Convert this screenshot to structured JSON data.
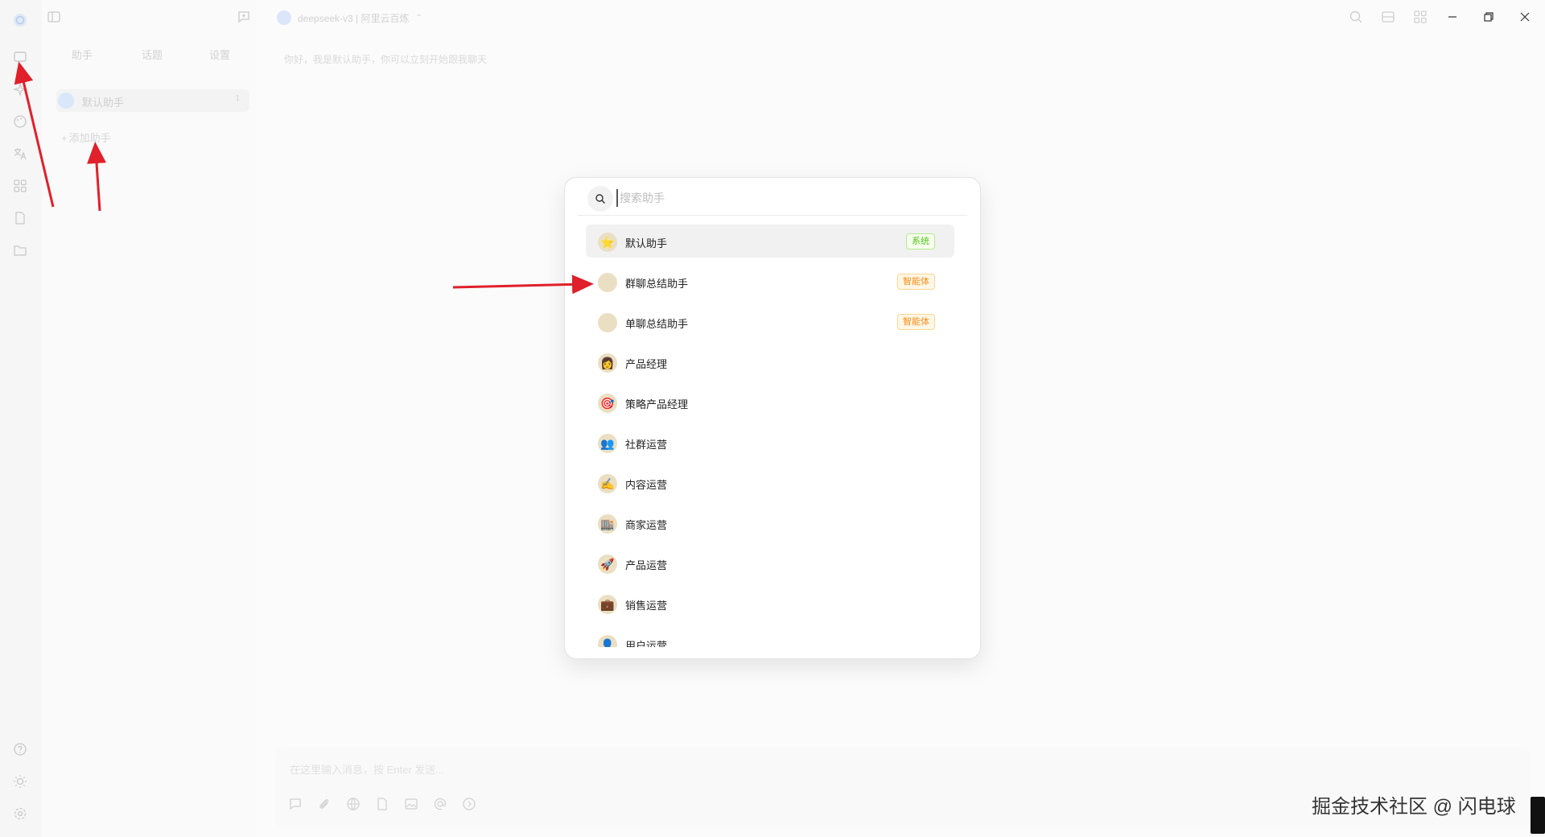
{
  "header": {
    "model_label": "deepseek-v3 | 阿里云百炼",
    "greeting": "你好，我是默认助手，你可以立刻开始跟我聊天"
  },
  "sidebar": {
    "tabs": [
      "助手",
      "话题",
      "设置"
    ],
    "assistant": {
      "label": "默认助手",
      "count": "1"
    },
    "add_label": "添加助手"
  },
  "input": {
    "placeholder": "在这里输入消息，按 Enter 发送..."
  },
  "modal": {
    "search_placeholder": "搜索助手",
    "items": [
      {
        "emoji": "⭐",
        "name": "默认助手",
        "tag": "系统",
        "tag_type": "sys",
        "active": true
      },
      {
        "emoji": "",
        "name": "群聊总结助手",
        "tag": "智能体",
        "tag_type": "agent"
      },
      {
        "emoji": "",
        "name": "单聊总结助手",
        "tag": "智能体",
        "tag_type": "agent"
      },
      {
        "emoji": "👩",
        "name": "产品经理",
        "tag": ""
      },
      {
        "emoji": "🎯",
        "name": "策略产品经理",
        "tag": ""
      },
      {
        "emoji": "👥",
        "name": "社群运营",
        "tag": ""
      },
      {
        "emoji": "✍️",
        "name": "内容运营",
        "tag": ""
      },
      {
        "emoji": "🏬",
        "name": "商家运营",
        "tag": ""
      },
      {
        "emoji": "🚀",
        "name": "产品运营",
        "tag": ""
      },
      {
        "emoji": "💼",
        "name": "销售运营",
        "tag": ""
      },
      {
        "emoji": "👤",
        "name": "用户运营",
        "tag": ""
      }
    ]
  },
  "watermark": "掘金技术社区 @ 闪电球",
  "colors": {
    "accent_arrow": "#e0202a",
    "tag_system": "#52c41a",
    "tag_agent": "#fa8c16"
  }
}
